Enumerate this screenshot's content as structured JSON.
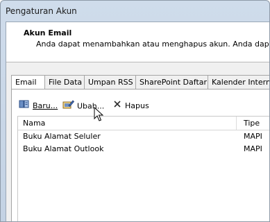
{
  "window": {
    "title": "Pengaturan Akun"
  },
  "header": {
    "title": "Akun Email",
    "description": "Anda dapat menambahkan atau menghapus akun. Anda dapat m"
  },
  "tabs": [
    {
      "label": "Email"
    },
    {
      "label": "File Data"
    },
    {
      "label": "Umpan RSS"
    },
    {
      "label": "SharePoint Daftar"
    },
    {
      "label": "Kalender Internet"
    }
  ],
  "active_tab": "Email",
  "toolbar": {
    "new_label": "Baru...",
    "change_label": "Ubah...",
    "remove_label": "Hapus",
    "new_icon": "address-book-icon",
    "change_icon": "edit-icon",
    "remove_icon": "x-icon"
  },
  "list": {
    "columns": [
      {
        "label": "Nama"
      },
      {
        "label": "Tipe"
      }
    ],
    "rows": [
      {
        "name": "Buku Alamat Seluler",
        "type": "MAPI"
      },
      {
        "name": "Buku Alamat Outlook",
        "type": "MAPI"
      }
    ]
  }
}
